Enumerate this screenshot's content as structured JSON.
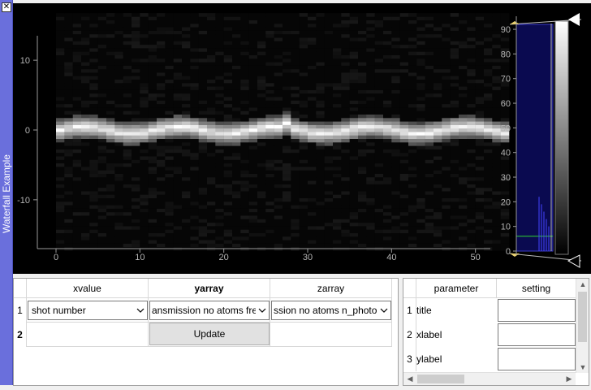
{
  "dock": {
    "title": "Waterfall Example",
    "close_label": "✕"
  },
  "plot": {
    "x_ticks": [
      "0",
      "10",
      "20",
      "30",
      "40",
      "50"
    ],
    "y_ticks": [
      "10",
      "0",
      "-10"
    ],
    "colorbar_ticks": [
      "90",
      "80",
      "70",
      "60",
      "50",
      "40",
      "30",
      "20",
      "10",
      "0"
    ]
  },
  "chart_data": {
    "type": "heatmap",
    "x_range": [
      0,
      54
    ],
    "y_range": [
      -17,
      17
    ],
    "x_ticks": [
      0,
      10,
      20,
      30,
      40,
      50
    ],
    "y_ticks": [
      10,
      0,
      -10
    ],
    "colorbar_range": [
      0,
      92
    ],
    "colorbar_ticks": [
      90,
      80,
      70,
      60,
      50,
      40,
      30,
      20,
      10,
      0
    ],
    "grid": false
  },
  "left_table": {
    "columns": [
      "xvalue",
      "yarray",
      "zarray"
    ],
    "rows": [
      {
        "num": "1",
        "xvalue": "shot number",
        "yarray": "ansmission no atoms freqs",
        "zarray": "ssion no atoms n_photons"
      },
      {
        "num": "2",
        "button": "Update"
      }
    ]
  },
  "right_table": {
    "columns": [
      "parameter",
      "setting"
    ],
    "rows": [
      {
        "num": "1",
        "parameter": "title"
      },
      {
        "num": "2",
        "parameter": "xlabel"
      },
      {
        "num": "3",
        "parameter": "ylabel"
      }
    ]
  },
  "colors": {
    "dock_strip": "#6a6fdc",
    "plot_background": "#000000",
    "contour": "#2fd62f",
    "histogram_fill": "#0a0a50"
  }
}
